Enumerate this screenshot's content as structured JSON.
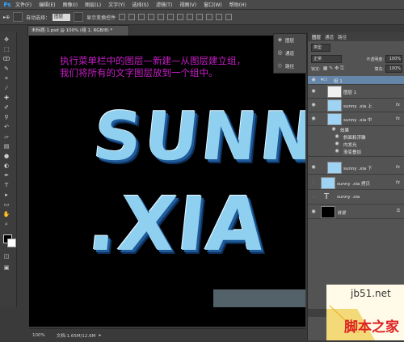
{
  "menu": {
    "logo": "Ps",
    "items": [
      "文件(F)",
      "编辑(E)",
      "图像(I)",
      "图层(L)",
      "文字(Y)",
      "选择(S)",
      "滤镜(T)",
      "视图(V)",
      "窗口(W)",
      "帮助(H)"
    ]
  },
  "options": {
    "auto_select_label": "自动选择：",
    "auto_select_value": "图层",
    "transform_label": "显示变换控件"
  },
  "document": {
    "tab_title": "未标题-1.psd @ 100% (组 1, RGB/8) *",
    "zoom": "100%",
    "doc_info": "文档:1.65M/12.6M"
  },
  "caption": {
    "line1": "执行菜单栏中的图层—新建—从图层建立组，",
    "line2": "我们将所有的文字图层放到一个组中。"
  },
  "artwork": {
    "word1": "SUNN",
    "word2": ".XIA"
  },
  "mini_panel": {
    "items": [
      "图层",
      "通道",
      "路径"
    ]
  },
  "layers_panel": {
    "tabs": [
      "图层",
      "通道",
      "路径"
    ],
    "kind": "类型",
    "blend_mode": "正常",
    "opacity_label": "不透明度:",
    "opacity_value": "100%",
    "lock_label": "锁定:",
    "fill_label": "填充:",
    "fill_value": "100%",
    "layers": [
      {
        "name": "组 1",
        "type": "group"
      },
      {
        "name": "图层 1",
        "type": "layer"
      },
      {
        "name": "sunny .xia 上",
        "type": "text",
        "fx": "fx"
      },
      {
        "name": "sunny .xia 中",
        "type": "text",
        "fx": "fx"
      },
      {
        "name": "效果",
        "type": "effect-header"
      },
      {
        "name": "斜面和浮雕",
        "type": "effect"
      },
      {
        "name": "内发光",
        "type": "effect"
      },
      {
        "name": "渐变叠加",
        "type": "effect"
      },
      {
        "name": "sunny .xia 下",
        "type": "text",
        "fx": "fx"
      },
      {
        "name": "sunny .xia 拷贝",
        "type": "text",
        "fx": "fx"
      },
      {
        "name": "sunny .xia",
        "type": "text-T"
      },
      {
        "name": "背景",
        "type": "background"
      }
    ]
  },
  "watermark": {
    "site": "jb51.net",
    "name": "脚本之家"
  }
}
